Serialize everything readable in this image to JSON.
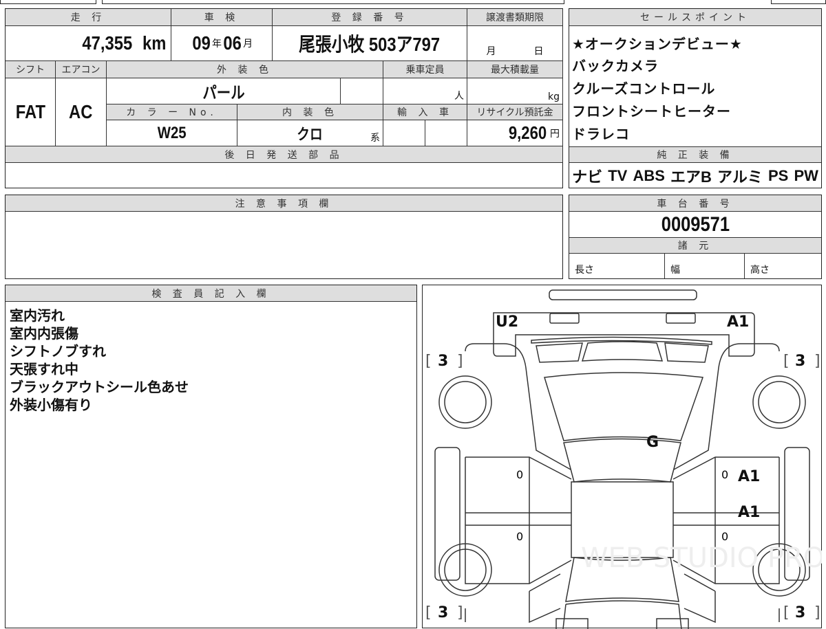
{
  "main_table": {
    "mileage_label": "走 行",
    "mileage_value": "47,355",
    "mileage_unit": "km",
    "inspection_label": "車 検",
    "inspection_year": "09",
    "year_unit": "年",
    "inspection_month": "06",
    "month_unit": "月",
    "registration_label": "登 録 番 号",
    "registration_value": "尾張小牧 503ア797",
    "transfer_deadline_label": "譲渡書類期限",
    "deadline_month": "月",
    "deadline_day": "日",
    "shift_label": "シフト",
    "shift_value": "FAT",
    "ac_label": "エアコン",
    "ac_value": "AC",
    "exterior_color_label": "外 装 色",
    "exterior_color_value": "パール",
    "capacity_label": "乗車定員",
    "capacity_unit": "人",
    "max_load_label": "最大積載量",
    "max_load_unit": "kg",
    "color_no_label": "カ ラ ー No.",
    "color_no_value": "W25",
    "interior_color_label": "内 装 色",
    "interior_color_value": "クロ",
    "interior_suffix": "系",
    "import_label": "輸 入 車",
    "recycle_label": "リサイクル預託金",
    "recycle_value": "9,260",
    "recycle_unit": "円",
    "later_parts_label": "後 日 発 送 部 品"
  },
  "sales_points": {
    "label": "セールスポイント",
    "items": [
      "★オークションデビュー★",
      "バックカメラ",
      "クルーズコントロール",
      "フロントシートヒーター",
      "ドラレコ"
    ]
  },
  "equipment": {
    "label": "純 正 装 備",
    "items": [
      "ナビ",
      "TV",
      "ABS",
      "エアB",
      "アルミ",
      "PS",
      "PW"
    ]
  },
  "notes": {
    "label": "注 意 事 項 欄"
  },
  "chassis": {
    "label": "車 台 番 号",
    "value": "0009571",
    "specs_label": "諸 元",
    "length": "長さ",
    "width": "幅",
    "height": "高さ"
  },
  "inspector": {
    "label": "検 査 員 記 入 欄",
    "items": [
      "室内汚れ",
      "室内内張傷",
      "シフトノブすれ",
      "天張すれ中",
      "ブラックアウトシール色あせ",
      "外装小傷有り"
    ]
  },
  "diagram": {
    "front_left": "U2",
    "front_right": "A1",
    "hood": "G",
    "right_front_door": "A1",
    "right_rear_door": "A1",
    "zero": "0",
    "tire": "3",
    "watermark": "WEB STUDIO PRO"
  }
}
